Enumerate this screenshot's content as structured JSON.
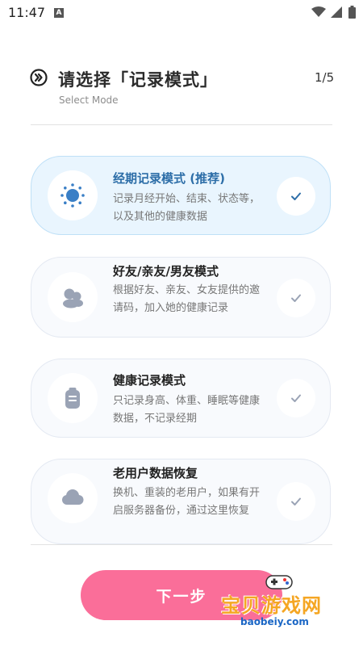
{
  "status_bar": {
    "time": "11:47",
    "notification_glyph": "A"
  },
  "header": {
    "title": "请选择「记录模式」",
    "subtitle": "Select Mode",
    "step": "1/5",
    "icon": "double-chevron-right-icon"
  },
  "modes": [
    {
      "title": "经期记录模式 (推荐)",
      "description": "记录月经开始、结束、状态等，以及其他的健康数据",
      "icon": "sun-icon",
      "selected": true
    },
    {
      "title": "好友/亲友/男友模式",
      "description": "根据好友、亲友、女友提供的邀请码，加入她的健康记录",
      "icon": "people-icon",
      "selected": false
    },
    {
      "title": "健康记录模式",
      "description": "只记录身高、体重、睡眠等健康数据，不记录经期",
      "icon": "clipboard-icon",
      "selected": false
    },
    {
      "title": "老用户数据恢复",
      "description": "换机、重装的老用户，如果有开启服务器备份，通过这里恢复",
      "icon": "cloud-icon",
      "selected": false
    }
  ],
  "next_button": {
    "label": "下一步"
  },
  "watermark": {
    "text": "宝贝游戏网",
    "url": "baobeiy.com"
  },
  "colors": {
    "accent": "#fa6e99",
    "selected_blue": "#2d6ea8",
    "selected_bg": "#e9f5fe",
    "icon_gray": "#9aa3b5"
  }
}
